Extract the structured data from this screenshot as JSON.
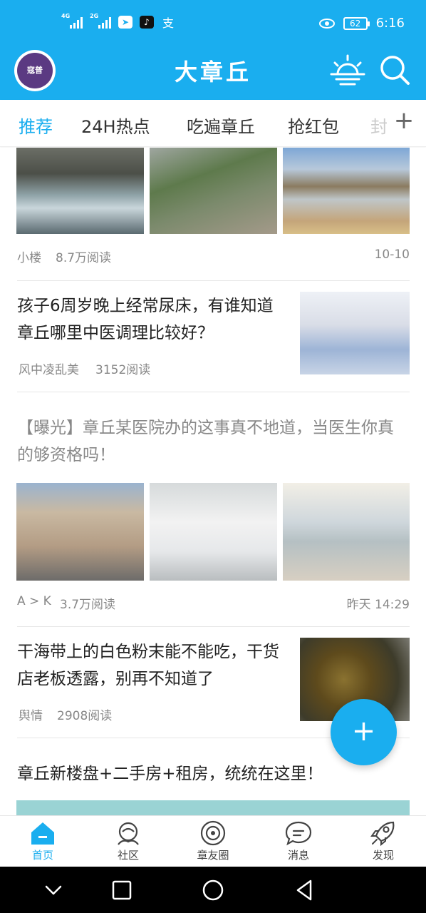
{
  "status_bar": {
    "net1": "4G",
    "net2": "2G",
    "battery": "62",
    "time": "6:16"
  },
  "app": {
    "title": "大章丘",
    "avatar_text": "寇普"
  },
  "tabs": [
    {
      "label": "推荐",
      "active": true
    },
    {
      "label": "24H热点"
    },
    {
      "label": "吃遍章丘"
    },
    {
      "label": "抢红包"
    },
    {
      "label": "封"
    }
  ],
  "feed": {
    "item1": {
      "author": "小楼",
      "reads": "8.7万阅读",
      "date": "10-10"
    },
    "item2": {
      "title": "孩子6周岁晚上经常尿床，有谁知道章丘哪里中医调理比较好？",
      "author": "风中凌乱美",
      "reads": "3152阅读"
    },
    "item3": {
      "title": "【曝光】章丘某医院办的这事真不地道，当医生你真的够资格吗！",
      "author": "A > K",
      "reads": "3.7万阅读",
      "date": "昨天 14:29"
    },
    "item4": {
      "title": "干海带上的白色粉末能不能吃，干货店老板透露，别再不知道了",
      "author": "舆情",
      "reads": "2908阅读"
    },
    "item5": {
      "title": "章丘新楼盘+二手房+租房，统统在这里！"
    }
  },
  "fab": {
    "label": "+"
  },
  "bottom_nav": [
    {
      "label": "首页",
      "icon": "home-icon",
      "active": true
    },
    {
      "label": "社区",
      "icon": "community-icon"
    },
    {
      "label": "章友圈",
      "icon": "circle-icon"
    },
    {
      "label": "消息",
      "icon": "message-icon"
    },
    {
      "label": "发现",
      "icon": "rocket-icon"
    }
  ],
  "colors": {
    "accent": "#1aaeef"
  }
}
